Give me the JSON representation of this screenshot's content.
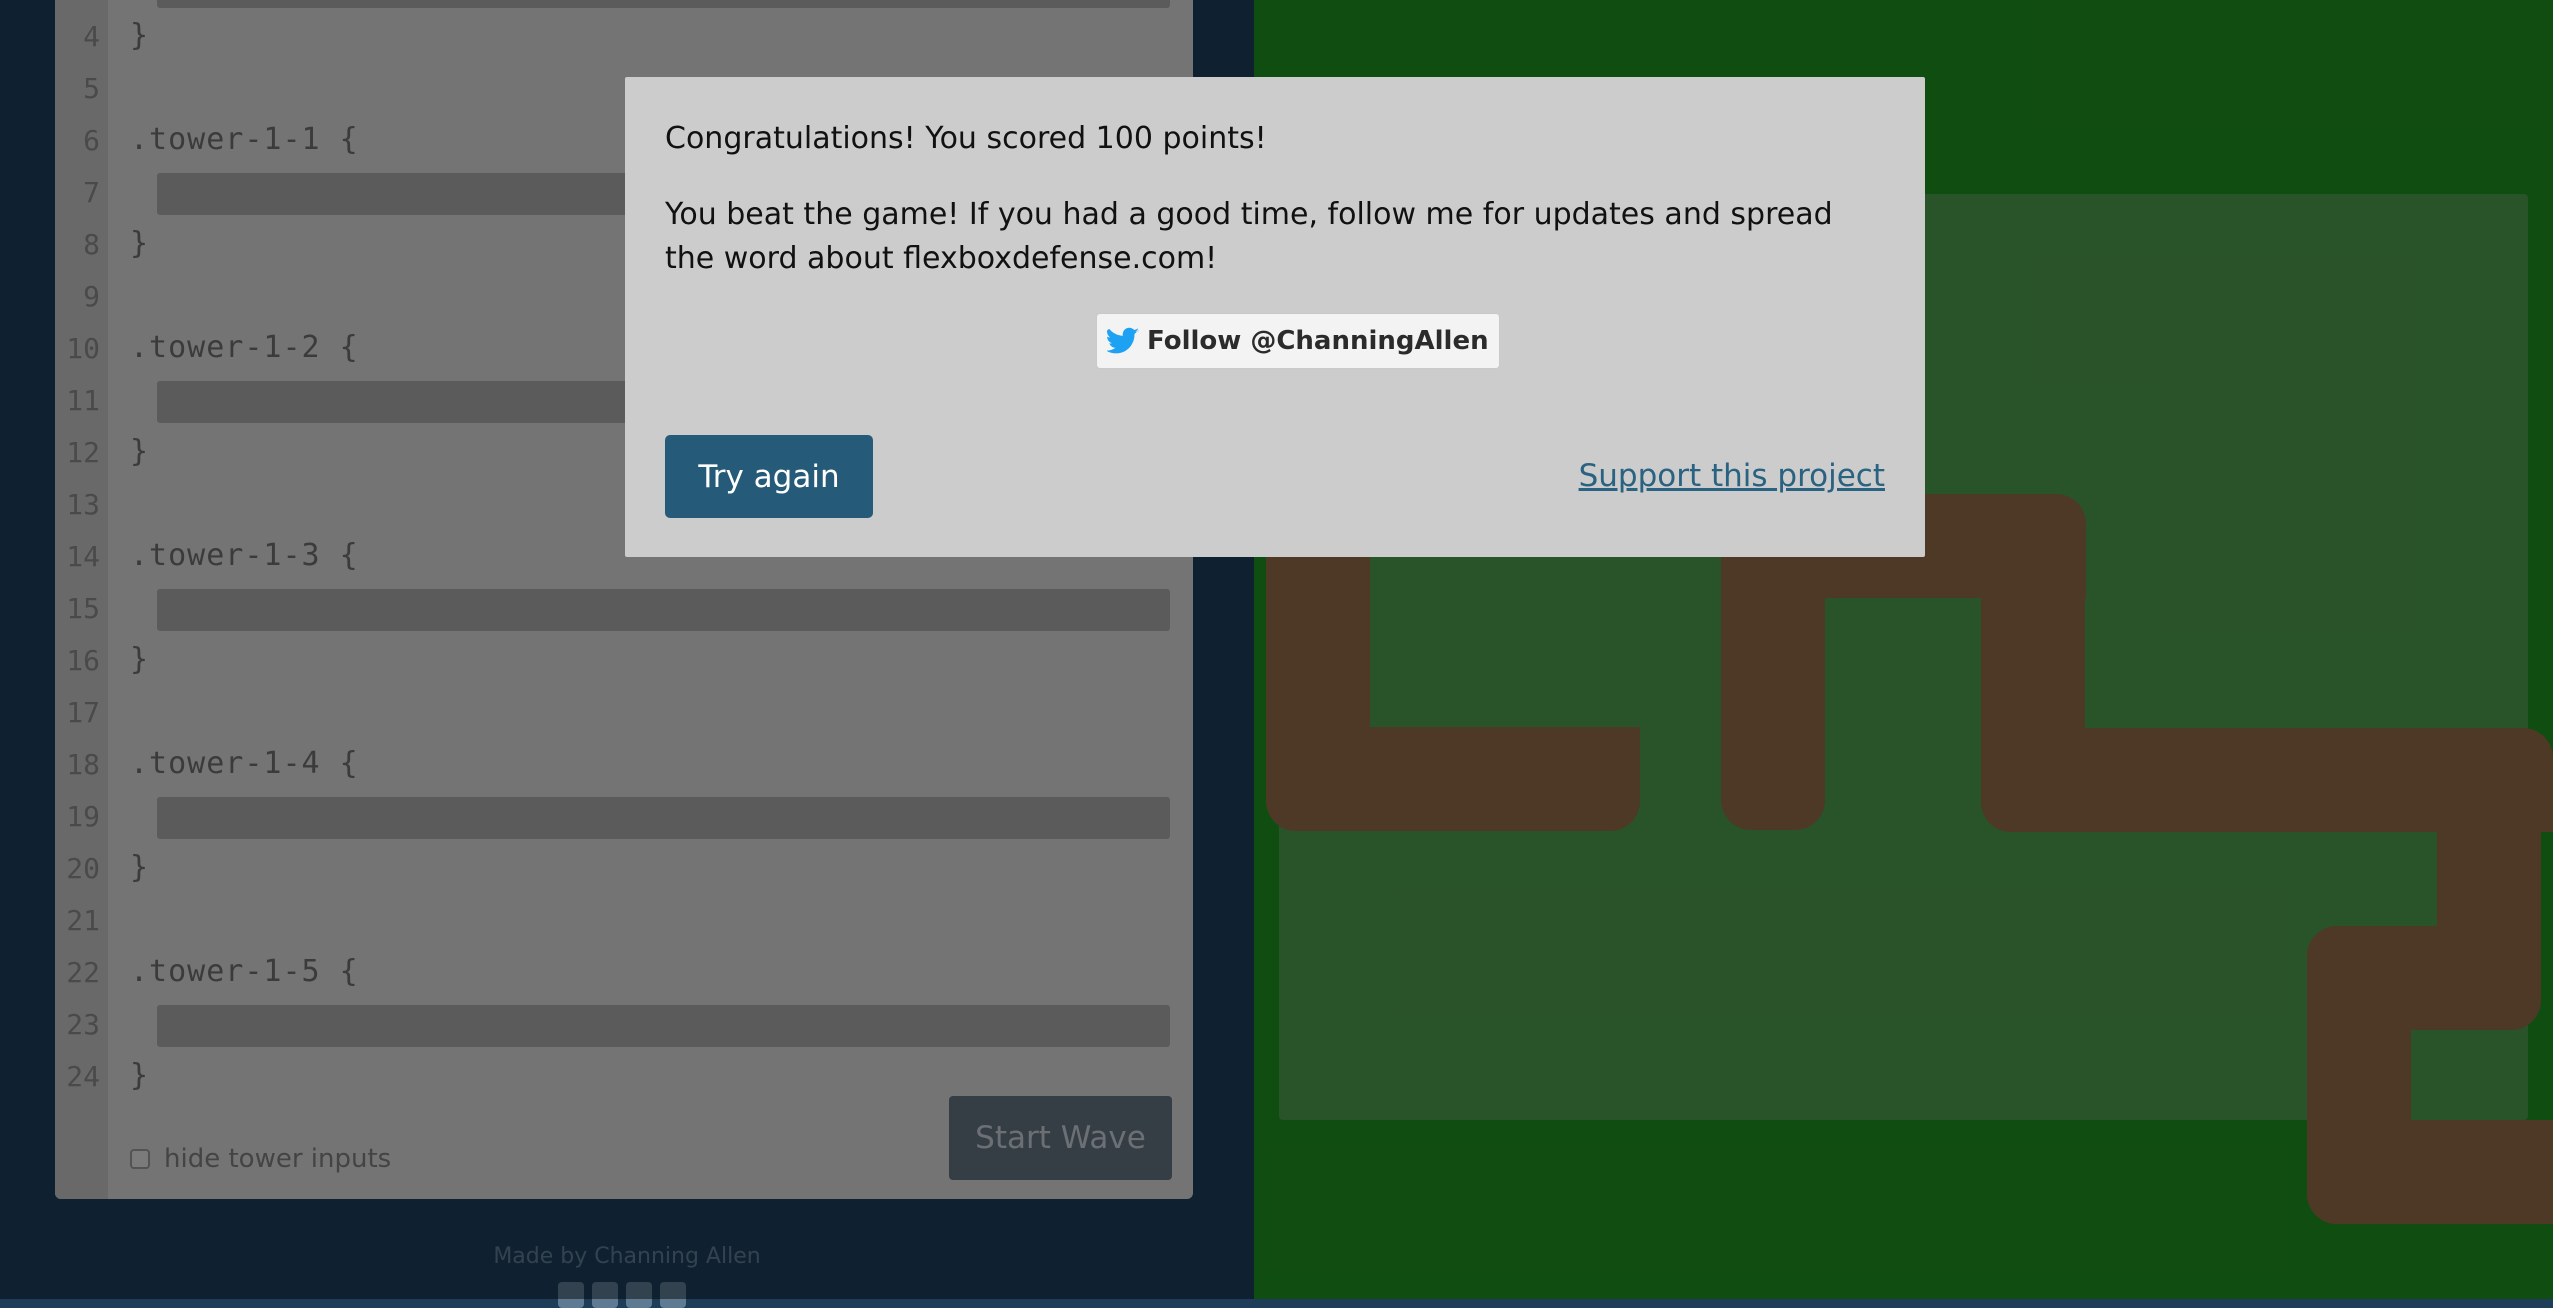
{
  "editor": {
    "lines": [
      {
        "num": "4",
        "code": "}"
      },
      {
        "num": "5",
        "code": ""
      },
      {
        "num": "6",
        "code": ".tower-1-1 {"
      },
      {
        "num": "7",
        "code": ""
      },
      {
        "num": "8",
        "code": "}"
      },
      {
        "num": "9",
        "code": ""
      },
      {
        "num": "10",
        "code": ".tower-1-2 {"
      },
      {
        "num": "11",
        "code": ""
      },
      {
        "num": "12",
        "code": "}"
      },
      {
        "num": "13",
        "code": ""
      },
      {
        "num": "14",
        "code": ".tower-1-3 {"
      },
      {
        "num": "15",
        "code": ""
      },
      {
        "num": "16",
        "code": "}"
      },
      {
        "num": "17",
        "code": ""
      },
      {
        "num": "18",
        "code": ".tower-1-4 {"
      },
      {
        "num": "19",
        "code": ""
      },
      {
        "num": "20",
        "code": "}"
      },
      {
        "num": "21",
        "code": ""
      },
      {
        "num": "22",
        "code": ".tower-1-5 {"
      },
      {
        "num": "23",
        "code": ""
      },
      {
        "num": "24",
        "code": "}"
      }
    ],
    "start_wave_label": "Start Wave",
    "hide_inputs_label": "hide tower inputs"
  },
  "footer": {
    "made_by": "Made by Channing Allen",
    "social_icons": [
      "facebook-icon",
      "twitter-icon",
      "linkedin-icon",
      "email-icon"
    ]
  },
  "modal": {
    "title": "Congratulations! You scored 100 points!",
    "body": "You beat the game! If you had a good time, follow me for updates and spread the word about flexboxdefense.com!",
    "follow_label": "Follow @ChanningAllen",
    "follow_icon": "twitter-bird-icon",
    "try_again_label": "Try again",
    "support_label": "Support this project"
  },
  "colors": {
    "board_green": "#1f8f1f",
    "path_brown": "#8f6a46",
    "primary_button": "#265a79",
    "link": "#2a6282"
  }
}
